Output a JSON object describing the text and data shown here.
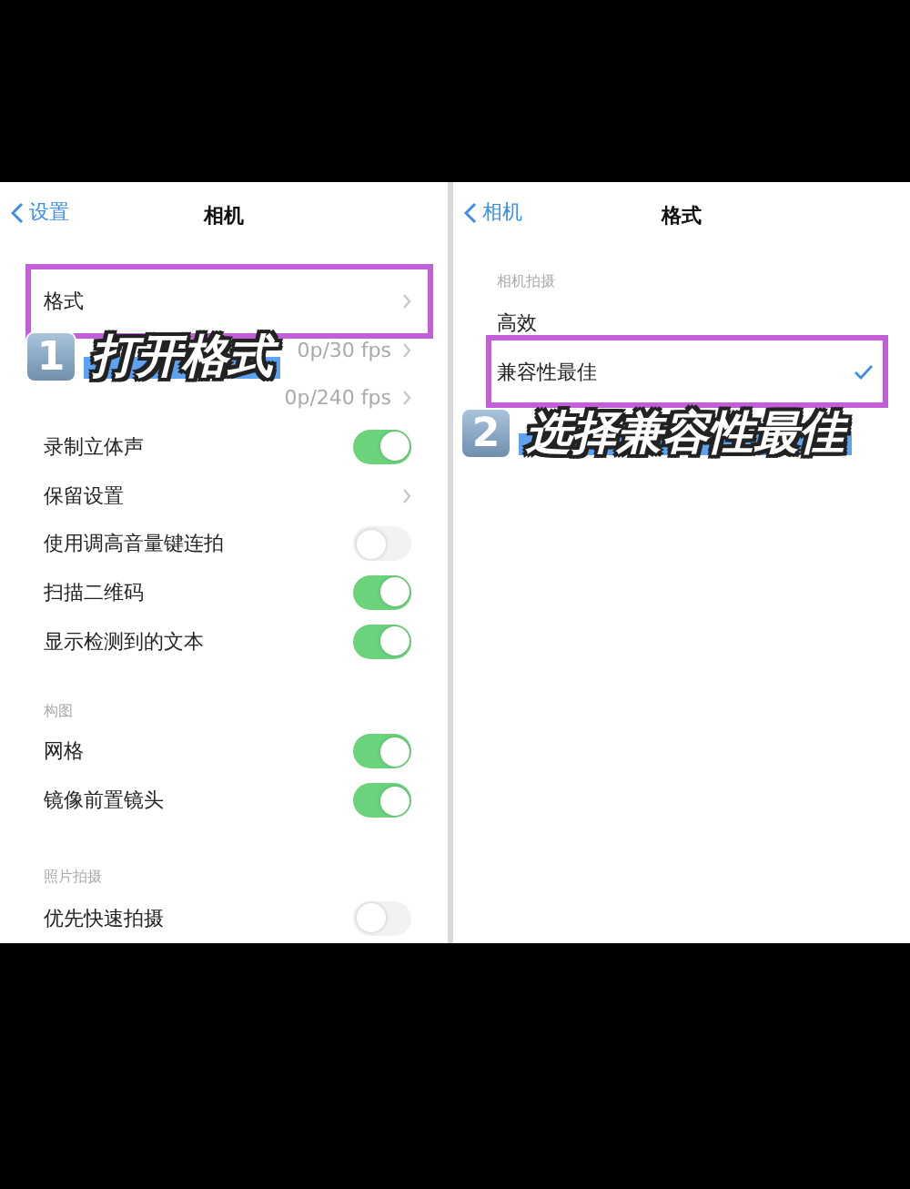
{
  "left": {
    "nav": {
      "back": "设置",
      "title": "相机"
    },
    "sections": [
      {
        "rows": [
          {
            "kind": "chevron",
            "label": "格式",
            "highlighted": true
          },
          {
            "kind": "chevron",
            "value": "0p/30 fps",
            "highlighted": false
          },
          {
            "kind": "chevron",
            "value": "0p/240 fps",
            "highlighted": false
          },
          {
            "kind": "toggle",
            "label": "录制立体声",
            "on": true,
            "highlighted": false
          },
          {
            "kind": "chevron",
            "label": "保留设置",
            "highlighted": false
          },
          {
            "kind": "toggle",
            "label": "使用调高音量键连拍",
            "on": false,
            "highlighted": false
          },
          {
            "kind": "toggle",
            "label": "扫描二维码",
            "on": true,
            "highlighted": false
          },
          {
            "kind": "toggle",
            "label": "显示检测到的文本",
            "on": true,
            "highlighted": false
          }
        ]
      },
      {
        "header": "构图",
        "rows": [
          {
            "kind": "toggle",
            "label": "网格",
            "on": true,
            "highlighted": false
          },
          {
            "kind": "toggle",
            "label": "镜像前置镜头",
            "on": true,
            "highlighted": false
          }
        ]
      },
      {
        "header": "照片拍摄",
        "rows": [
          {
            "kind": "toggle",
            "label": "优先快速拍摄",
            "on": false,
            "highlighted": false
          }
        ]
      }
    ]
  },
  "right": {
    "nav": {
      "back": "相机",
      "title": "格式"
    },
    "header": "相机拍摄",
    "options": [
      {
        "label": "高效",
        "selected": false,
        "highlighted": false
      },
      {
        "label": "兼容性最佳",
        "selected": true,
        "highlighted": true
      }
    ]
  },
  "annotations": [
    {
      "number": "1",
      "caption": "打开格式"
    },
    {
      "number": "2",
      "caption": "选择兼容性最佳"
    }
  ]
}
